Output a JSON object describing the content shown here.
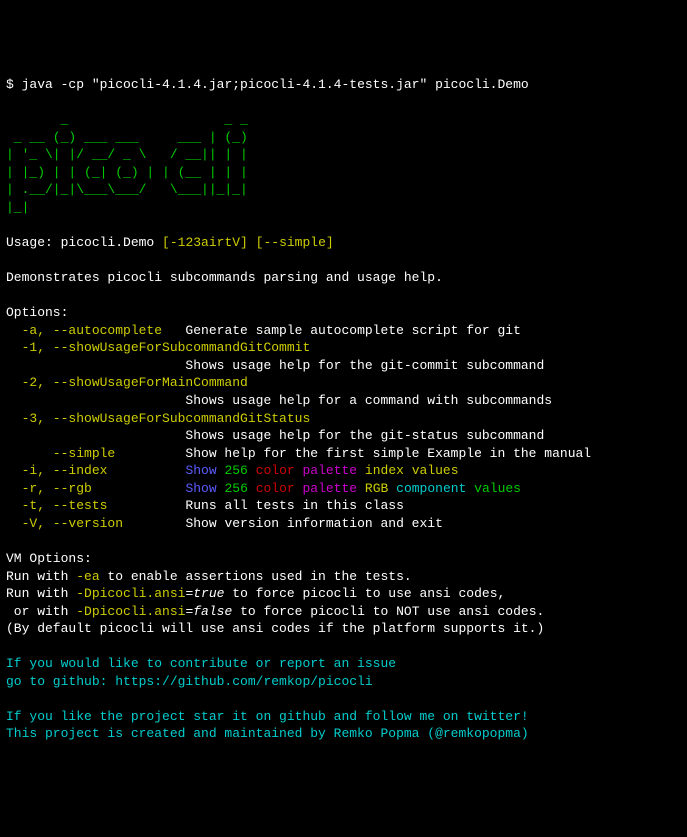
{
  "command": {
    "prompt": "$ ",
    "text": "java -cp \"picocli-4.1.4.jar;picocli-4.1.4-tests.jar\" picocli.Demo"
  },
  "logo": {
    "line1": "       _                    _ _",
    "line2": " _ __ (_) ___ ___     ___ | (_)",
    "line3": "| '_ \\| |/ __/ _ \\   / __|| | |",
    "line4": "| |_) | | (_| (_) | | (__ | | |",
    "line5": "| .__/|_|\\___\\___/   \\___||_|_|",
    "line6": "|_|"
  },
  "usage": {
    "label": "Usage: ",
    "cmd": "picocli.Demo",
    "opts1": " [-123airtV]",
    "opts2": " [--simple]"
  },
  "description": "Demonstrates picocli subcommands parsing and usage help.",
  "options_header": "Options:",
  "options": [
    {
      "flag": "  -a, --autocomplete",
      "desc": "   Generate sample autocomplete script for git"
    },
    {
      "flag": "  -1, --showUsageForSubcommandGitCommit",
      "desc": ""
    },
    {
      "flag": "",
      "desc": "                       Shows usage help for the git-commit subcommand"
    },
    {
      "flag": "  -2, --showUsageForMainCommand",
      "desc": ""
    },
    {
      "flag": "",
      "desc": "                       Shows usage help for a command with subcommands"
    },
    {
      "flag": "  -3, --showUsageForSubcommandGitStatus",
      "desc": ""
    },
    {
      "flag": "",
      "desc": "                       Shows usage help for the git-status subcommand"
    },
    {
      "flag": "      --simple",
      "desc": "         Show help for the first simple Example in the manual"
    },
    {
      "flag": "  -i, --index",
      "desc_pre": "          ",
      "word_show": "Show",
      "num": " 256",
      "word_color": " color",
      "word_palette": " palette",
      "word_tail": " index values"
    },
    {
      "flag": "  -r, --rgb",
      "desc_pre": "            ",
      "word_show": "Show",
      "num": " 256",
      "word_color": " color",
      "word_palette": " palette",
      "word_tail2a": " RGB",
      "word_tail2b": " component",
      "word_tail2c": " values"
    },
    {
      "flag": "  -t, --tests",
      "desc": "          Runs all tests in this class"
    },
    {
      "flag": "  -V, --version",
      "desc": "        Show version information and exit"
    }
  ],
  "vm": {
    "header": "VM Options:",
    "line1a": "Run with ",
    "line1b": "-ea",
    "line1c": " to enable assertions used in the tests.",
    "line2a": "Run with ",
    "line2b": "-Dpicocli.ansi",
    "line2c": "=",
    "line2d": "true",
    "line2e": " to force picocli to use ansi codes,",
    "line3a": " or with ",
    "line3b": "-Dpicocli.ansi",
    "line3c": "=",
    "line3d": "false",
    "line3e": " to force picocli to NOT use ansi codes.",
    "line4": "(By default picocli will use ansi codes if the platform supports it.)"
  },
  "footer": {
    "line1": "If you would like to contribute or report an issue",
    "line2": "go to github: https://github.com/remkop/picocli",
    "line3": "If you like the project star it on github and follow me on twitter!",
    "line4": "This project is created and maintained by Remko Popma (@remkopopma)"
  }
}
